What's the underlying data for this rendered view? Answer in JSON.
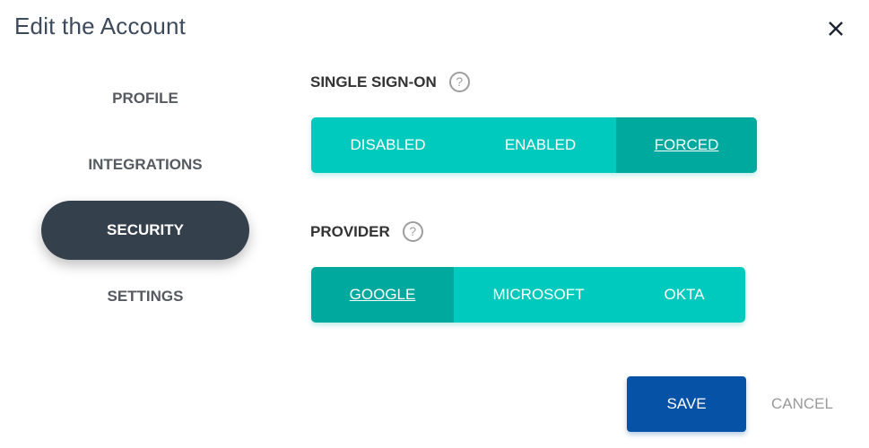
{
  "dialog": {
    "title": "Edit the Account",
    "close_icon": "close-icon"
  },
  "nav": {
    "items": [
      {
        "label": "PROFILE",
        "active": false
      },
      {
        "label": "INTEGRATIONS",
        "active": false
      },
      {
        "label": "SECURITY",
        "active": true
      },
      {
        "label": "SETTINGS",
        "active": false
      }
    ]
  },
  "sso": {
    "label": "SINGLE SIGN-ON",
    "help_icon": "?",
    "options": [
      "DISABLED",
      "ENABLED",
      "FORCED"
    ],
    "selected": "FORCED"
  },
  "provider": {
    "label": "PROVIDER",
    "help_icon": "?",
    "options": [
      "GOOGLE",
      "MICROSOFT",
      "OKTA"
    ],
    "selected": "GOOGLE"
  },
  "actions": {
    "save_label": "SAVE",
    "cancel_label": "CANCEL"
  },
  "colors": {
    "accent": "#00c9bd",
    "accent_selected": "#00a99e",
    "primary": "#0652a6",
    "nav_active": "#35404d"
  }
}
